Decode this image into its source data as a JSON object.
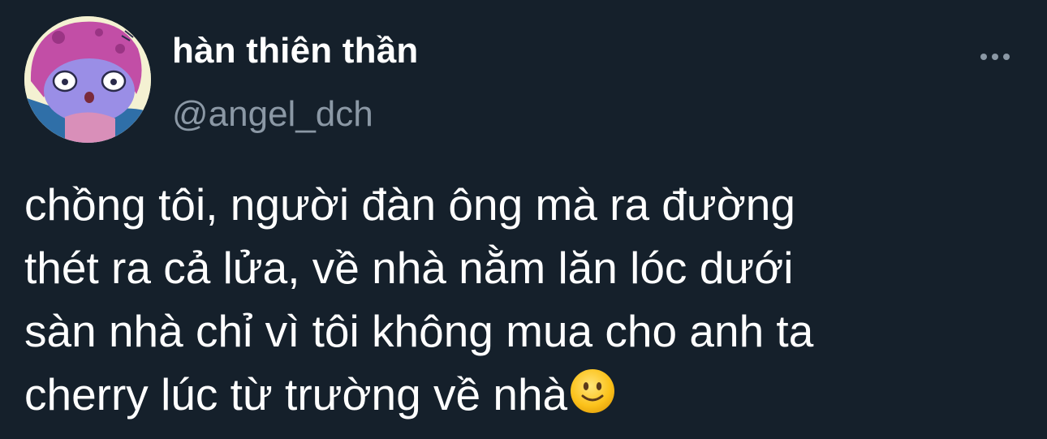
{
  "tweet": {
    "author": {
      "display_name": "hàn thiên thần",
      "handle": "@angel_dch",
      "avatar_icon": "cartoon-avatar-icon"
    },
    "more_icon": "more-options-icon",
    "text": "chồng tôi, người đàn ông mà ra đường\nthét ra cả lửa, về nhà nằm lăn lóc dưới\nsàn nhà chỉ vì tôi không mua cho anh ta\ncherry lúc từ trường về nhà",
    "trailing_emoji": "slightly-smiling-face-emoji"
  },
  "colors": {
    "background": "#15202b",
    "primary_text": "#ffffff",
    "secondary_text": "#8b98a5"
  }
}
